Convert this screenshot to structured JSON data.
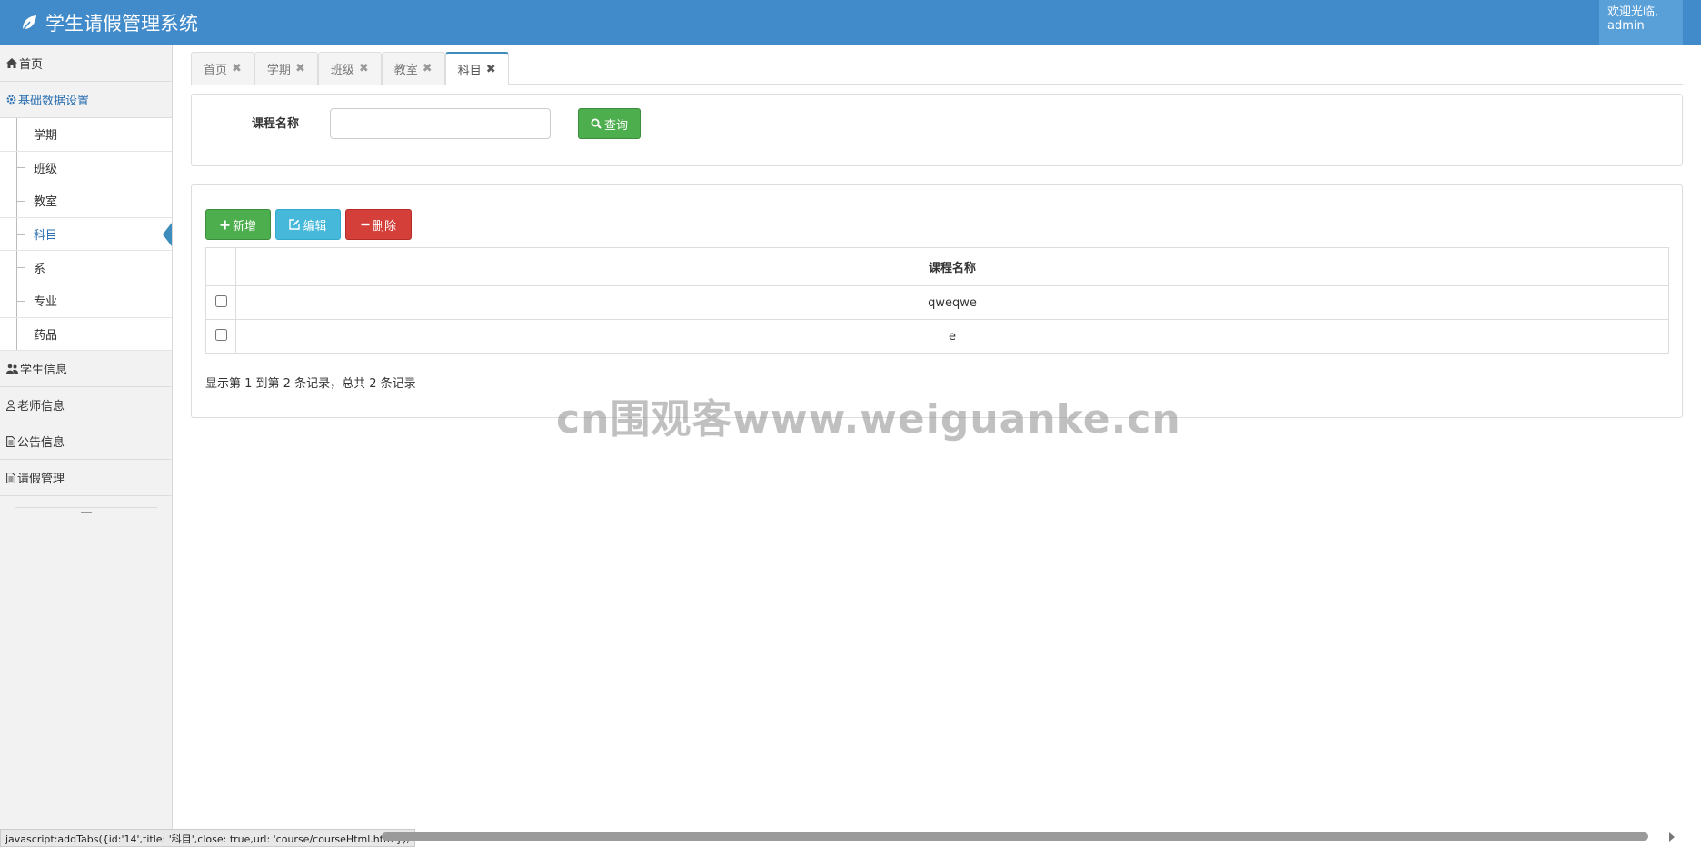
{
  "header": {
    "title": "学生请假管理系统",
    "welcome_line1": "欢迎光临,",
    "welcome_line2": "admin"
  },
  "sidebar": {
    "home": "首页",
    "basic": "基础数据设置",
    "basic_items": [
      "学期",
      "班级",
      "教室",
      "科目",
      "系",
      "专业",
      "药品"
    ],
    "student": "学生信息",
    "teacher": "老师信息",
    "notice": "公告信息",
    "leave": "请假管理"
  },
  "tabs": [
    {
      "label": "首页"
    },
    {
      "label": "学期"
    },
    {
      "label": "班级"
    },
    {
      "label": "教室"
    },
    {
      "label": "科目"
    }
  ],
  "search": {
    "label": "课程名称",
    "value": "",
    "button": "查询"
  },
  "toolbar": {
    "add": "新增",
    "edit": "编辑",
    "delete": "删除"
  },
  "table": {
    "header": "课程名称",
    "rows": [
      "qweqwe",
      "e"
    ]
  },
  "pager": "显示第 1 到第 2 条记录，总共 2 条记录",
  "watermark": "cn围观客www.weiguanke.cn",
  "statusbar": "javascript:addTabs({id:'14',title: '科目',close: true,url: 'course/courseHtml.htm'});",
  "colors": {
    "header": "#428bca",
    "success": "#4cae4c",
    "info": "#46b8da",
    "danger": "#d43f3a"
  }
}
